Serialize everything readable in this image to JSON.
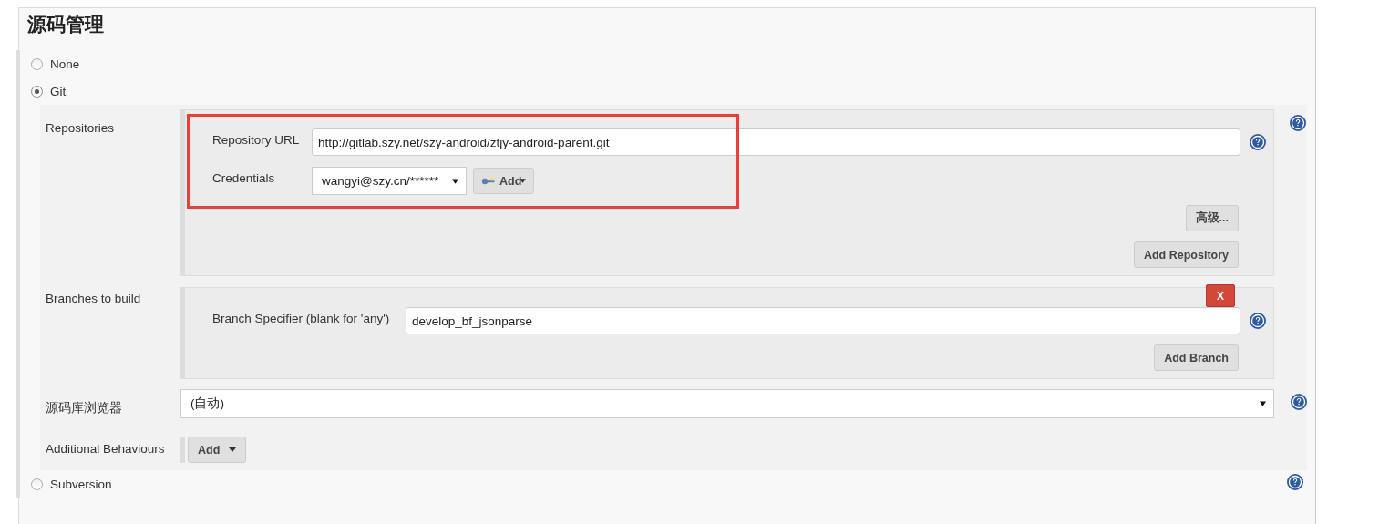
{
  "heading": "源码管理",
  "scm_options": [
    {
      "label": "None",
      "selected": false
    },
    {
      "label": "Git",
      "selected": true
    },
    {
      "label": "Subversion",
      "selected": false
    }
  ],
  "repositories": {
    "label": "Repositories",
    "url_label": "Repository URL",
    "url": "http://gitlab.szy.net/szy-android/ztjy-android-parent.git",
    "credentials_label": "Credentials",
    "credentials": "wangyi@szy.cn/******",
    "add_button": "Add",
    "advanced_button": "高级...",
    "add_repository_button": "Add Repository"
  },
  "branches": {
    "label": "Branches to build",
    "delete_button": "X",
    "specifier_label": "Branch Specifier (blank for 'any')",
    "specifier": "develop_bf_jsonparse",
    "add_branch_button": "Add Branch"
  },
  "browser": {
    "label": "源码库浏览器",
    "value": "(自动)"
  },
  "additional": {
    "label": "Additional Behaviours",
    "add_button": "Add"
  }
}
